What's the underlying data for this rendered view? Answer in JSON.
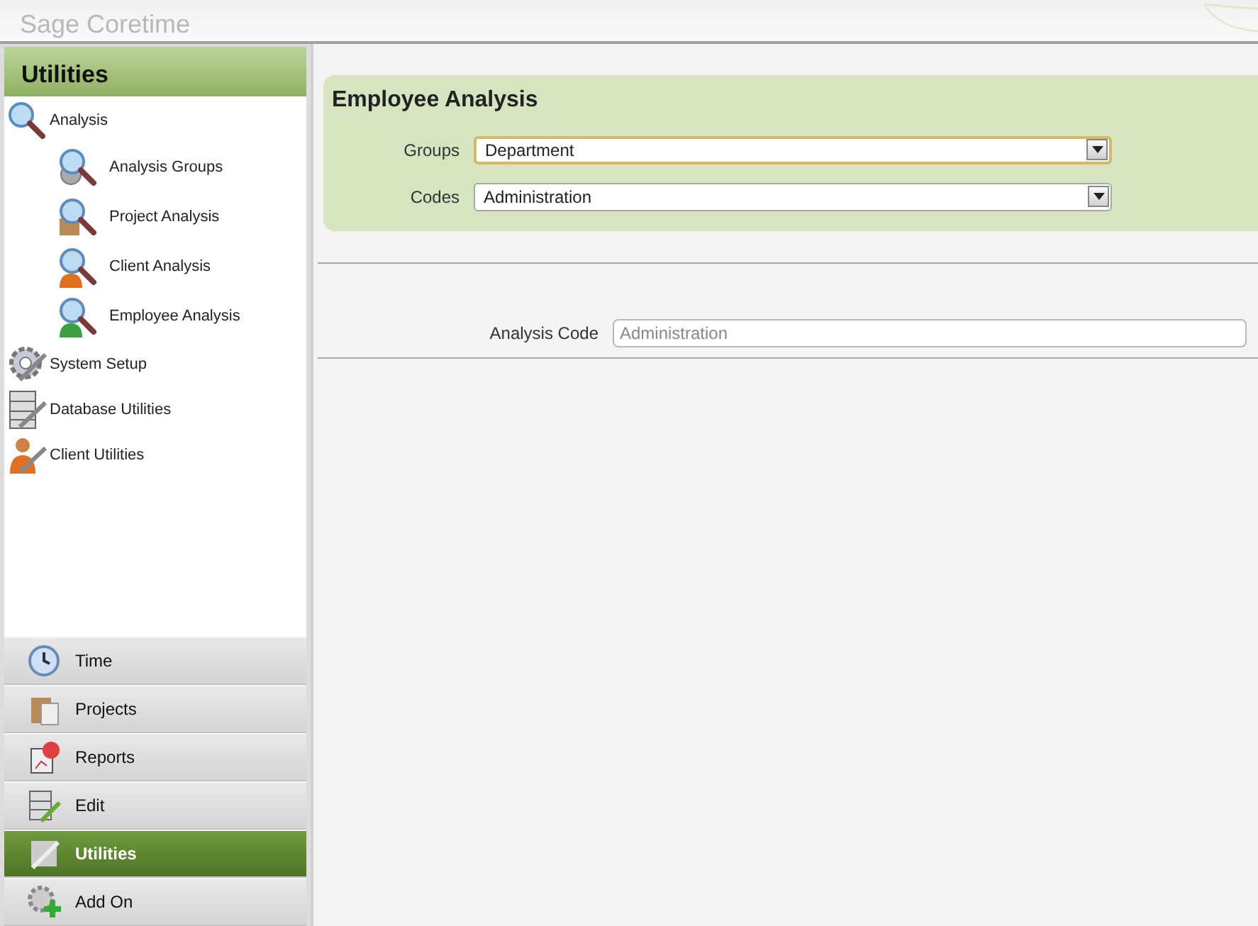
{
  "app": {
    "title": "Sage Coretime"
  },
  "sidebar": {
    "title": "Utilities",
    "tree": [
      {
        "label": "Analysis",
        "children": [
          {
            "label": "Analysis Groups"
          },
          {
            "label": "Project Analysis"
          },
          {
            "label": "Client Analysis"
          },
          {
            "label": "Employee Analysis"
          }
        ]
      },
      {
        "label": "System Setup"
      },
      {
        "label": "Database Utilities"
      },
      {
        "label": "Client Utilities"
      }
    ],
    "nav": [
      {
        "label": "Time",
        "selected": false
      },
      {
        "label": "Projects",
        "selected": false
      },
      {
        "label": "Reports",
        "selected": false
      },
      {
        "label": "Edit",
        "selected": false
      },
      {
        "label": "Utilities",
        "selected": true
      },
      {
        "label": "Add On",
        "selected": false
      }
    ]
  },
  "form": {
    "title": "Employee Analysis",
    "fields": [
      {
        "label": "Groups",
        "value": "Department",
        "focused": true
      },
      {
        "label": "Codes",
        "value": "Administration",
        "focused": false
      }
    ]
  },
  "detail": {
    "label": "Analysis Code",
    "value": "Administration",
    "disabled": true
  }
}
